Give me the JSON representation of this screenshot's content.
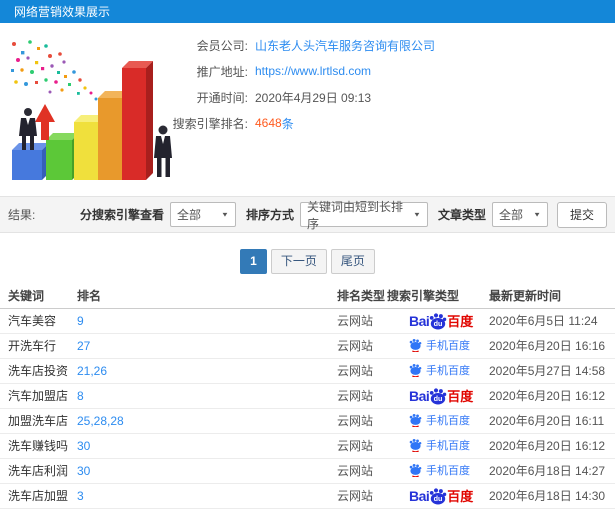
{
  "header": {
    "title": "网络营销效果展示"
  },
  "info": {
    "rows": [
      {
        "label": "会员公司:",
        "value": "山东老人头汽车服务咨询有限公司"
      },
      {
        "label": "推广地址:",
        "value": "https://www.lrtlsd.com"
      },
      {
        "label": "开通时间:",
        "value": "2020年4月29日 09:13"
      },
      {
        "label": "搜索引擎排名:",
        "value": "4648",
        "suffix": "条"
      }
    ]
  },
  "filters": {
    "result_label": "结果:",
    "engine_label": "分搜索引擎查看",
    "engine_value": "全部",
    "sort_label": "排序方式",
    "sort_value": "关键词由短到长排序",
    "article_label": "文章类型",
    "article_value": "全部",
    "submit_label": "提交"
  },
  "pagination": {
    "current": "1",
    "next": "下一页",
    "last": "尾页"
  },
  "table": {
    "headers": [
      "关键词",
      "排名",
      "排名类型",
      "搜索引擎类型",
      "最新更新时间"
    ],
    "rows": [
      {
        "keyword": "汽车美容",
        "rank": "9",
        "rank_type": "云网站",
        "engine": "baidu-pc",
        "updated": "2020年6月5日 11:24"
      },
      {
        "keyword": "开洗车行",
        "rank": "27",
        "rank_type": "云网站",
        "engine": "baidu-mobile",
        "updated": "2020年6月20日 16:16"
      },
      {
        "keyword": "洗车店投资",
        "rank": "21,26",
        "rank_type": "云网站",
        "engine": "baidu-mobile",
        "updated": "2020年5月27日 14:58"
      },
      {
        "keyword": "汽车加盟店",
        "rank": "8",
        "rank_type": "云网站",
        "engine": "baidu-pc",
        "updated": "2020年6月20日 16:12"
      },
      {
        "keyword": "加盟洗车店",
        "rank": "25,28,28",
        "rank_type": "云网站",
        "engine": "baidu-mobile",
        "updated": "2020年6月20日 16:11"
      },
      {
        "keyword": "洗车赚钱吗",
        "rank": "30",
        "rank_type": "云网站",
        "engine": "baidu-mobile",
        "updated": "2020年6月20日 16:12"
      },
      {
        "keyword": "洗车店利润",
        "rank": "30",
        "rank_type": "云网站",
        "engine": "baidu-mobile",
        "updated": "2020年6月18日 14:27"
      },
      {
        "keyword": "洗车店加盟",
        "rank": "3",
        "rank_type": "云网站",
        "engine": "baidu-pc",
        "updated": "2020年6月18日 14:30"
      }
    ]
  },
  "engines": {
    "baidu_pc": {
      "bai": "Bai",
      "du": "du",
      "baidu": "百度"
    },
    "baidu_mobile": {
      "label": "手机百度"
    }
  },
  "colors": {
    "header_bg": "#1487d8",
    "link_blue": "#2d8cf0",
    "rank_count_orange": "#ff5a1e",
    "pagination_active_bg": "#337ab7",
    "baidu_blue": "#2633d8",
    "baidu_red": "#e10601",
    "mobile_baidu_blue": "#3076f6"
  }
}
